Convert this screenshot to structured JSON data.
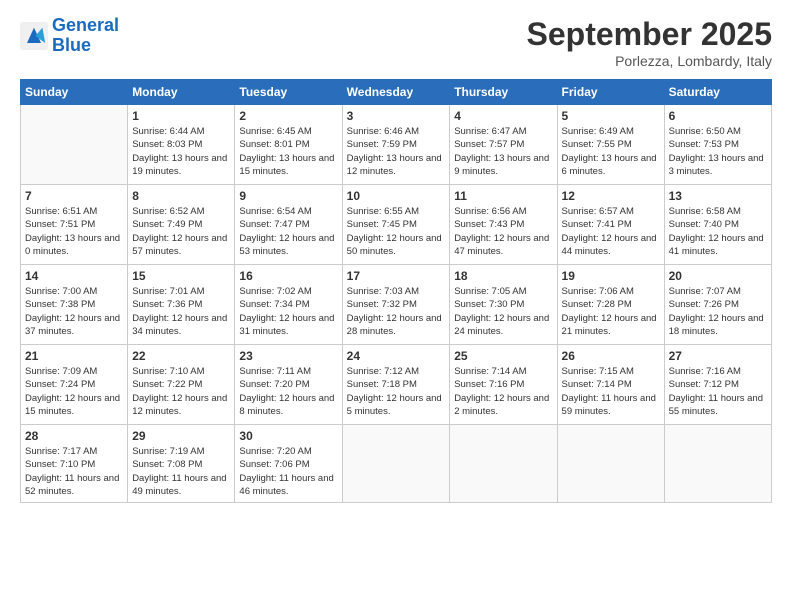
{
  "logo": {
    "line1": "General",
    "line2": "Blue"
  },
  "title": "September 2025",
  "location": "Porlezza, Lombardy, Italy",
  "days_of_week": [
    "Sunday",
    "Monday",
    "Tuesday",
    "Wednesday",
    "Thursday",
    "Friday",
    "Saturday"
  ],
  "weeks": [
    [
      {
        "day": "",
        "sunrise": "",
        "sunset": "",
        "daylight": ""
      },
      {
        "day": "1",
        "sunrise": "Sunrise: 6:44 AM",
        "sunset": "Sunset: 8:03 PM",
        "daylight": "Daylight: 13 hours and 19 minutes."
      },
      {
        "day": "2",
        "sunrise": "Sunrise: 6:45 AM",
        "sunset": "Sunset: 8:01 PM",
        "daylight": "Daylight: 13 hours and 15 minutes."
      },
      {
        "day": "3",
        "sunrise": "Sunrise: 6:46 AM",
        "sunset": "Sunset: 7:59 PM",
        "daylight": "Daylight: 13 hours and 12 minutes."
      },
      {
        "day": "4",
        "sunrise": "Sunrise: 6:47 AM",
        "sunset": "Sunset: 7:57 PM",
        "daylight": "Daylight: 13 hours and 9 minutes."
      },
      {
        "day": "5",
        "sunrise": "Sunrise: 6:49 AM",
        "sunset": "Sunset: 7:55 PM",
        "daylight": "Daylight: 13 hours and 6 minutes."
      },
      {
        "day": "6",
        "sunrise": "Sunrise: 6:50 AM",
        "sunset": "Sunset: 7:53 PM",
        "daylight": "Daylight: 13 hours and 3 minutes."
      }
    ],
    [
      {
        "day": "7",
        "sunrise": "Sunrise: 6:51 AM",
        "sunset": "Sunset: 7:51 PM",
        "daylight": "Daylight: 13 hours and 0 minutes."
      },
      {
        "day": "8",
        "sunrise": "Sunrise: 6:52 AM",
        "sunset": "Sunset: 7:49 PM",
        "daylight": "Daylight: 12 hours and 57 minutes."
      },
      {
        "day": "9",
        "sunrise": "Sunrise: 6:54 AM",
        "sunset": "Sunset: 7:47 PM",
        "daylight": "Daylight: 12 hours and 53 minutes."
      },
      {
        "day": "10",
        "sunrise": "Sunrise: 6:55 AM",
        "sunset": "Sunset: 7:45 PM",
        "daylight": "Daylight: 12 hours and 50 minutes."
      },
      {
        "day": "11",
        "sunrise": "Sunrise: 6:56 AM",
        "sunset": "Sunset: 7:43 PM",
        "daylight": "Daylight: 12 hours and 47 minutes."
      },
      {
        "day": "12",
        "sunrise": "Sunrise: 6:57 AM",
        "sunset": "Sunset: 7:41 PM",
        "daylight": "Daylight: 12 hours and 44 minutes."
      },
      {
        "day": "13",
        "sunrise": "Sunrise: 6:58 AM",
        "sunset": "Sunset: 7:40 PM",
        "daylight": "Daylight: 12 hours and 41 minutes."
      }
    ],
    [
      {
        "day": "14",
        "sunrise": "Sunrise: 7:00 AM",
        "sunset": "Sunset: 7:38 PM",
        "daylight": "Daylight: 12 hours and 37 minutes."
      },
      {
        "day": "15",
        "sunrise": "Sunrise: 7:01 AM",
        "sunset": "Sunset: 7:36 PM",
        "daylight": "Daylight: 12 hours and 34 minutes."
      },
      {
        "day": "16",
        "sunrise": "Sunrise: 7:02 AM",
        "sunset": "Sunset: 7:34 PM",
        "daylight": "Daylight: 12 hours and 31 minutes."
      },
      {
        "day": "17",
        "sunrise": "Sunrise: 7:03 AM",
        "sunset": "Sunset: 7:32 PM",
        "daylight": "Daylight: 12 hours and 28 minutes."
      },
      {
        "day": "18",
        "sunrise": "Sunrise: 7:05 AM",
        "sunset": "Sunset: 7:30 PM",
        "daylight": "Daylight: 12 hours and 24 minutes."
      },
      {
        "day": "19",
        "sunrise": "Sunrise: 7:06 AM",
        "sunset": "Sunset: 7:28 PM",
        "daylight": "Daylight: 12 hours and 21 minutes."
      },
      {
        "day": "20",
        "sunrise": "Sunrise: 7:07 AM",
        "sunset": "Sunset: 7:26 PM",
        "daylight": "Daylight: 12 hours and 18 minutes."
      }
    ],
    [
      {
        "day": "21",
        "sunrise": "Sunrise: 7:09 AM",
        "sunset": "Sunset: 7:24 PM",
        "daylight": "Daylight: 12 hours and 15 minutes."
      },
      {
        "day": "22",
        "sunrise": "Sunrise: 7:10 AM",
        "sunset": "Sunset: 7:22 PM",
        "daylight": "Daylight: 12 hours and 12 minutes."
      },
      {
        "day": "23",
        "sunrise": "Sunrise: 7:11 AM",
        "sunset": "Sunset: 7:20 PM",
        "daylight": "Daylight: 12 hours and 8 minutes."
      },
      {
        "day": "24",
        "sunrise": "Sunrise: 7:12 AM",
        "sunset": "Sunset: 7:18 PM",
        "daylight": "Daylight: 12 hours and 5 minutes."
      },
      {
        "day": "25",
        "sunrise": "Sunrise: 7:14 AM",
        "sunset": "Sunset: 7:16 PM",
        "daylight": "Daylight: 12 hours and 2 minutes."
      },
      {
        "day": "26",
        "sunrise": "Sunrise: 7:15 AM",
        "sunset": "Sunset: 7:14 PM",
        "daylight": "Daylight: 11 hours and 59 minutes."
      },
      {
        "day": "27",
        "sunrise": "Sunrise: 7:16 AM",
        "sunset": "Sunset: 7:12 PM",
        "daylight": "Daylight: 11 hours and 55 minutes."
      }
    ],
    [
      {
        "day": "28",
        "sunrise": "Sunrise: 7:17 AM",
        "sunset": "Sunset: 7:10 PM",
        "daylight": "Daylight: 11 hours and 52 minutes."
      },
      {
        "day": "29",
        "sunrise": "Sunrise: 7:19 AM",
        "sunset": "Sunset: 7:08 PM",
        "daylight": "Daylight: 11 hours and 49 minutes."
      },
      {
        "day": "30",
        "sunrise": "Sunrise: 7:20 AM",
        "sunset": "Sunset: 7:06 PM",
        "daylight": "Daylight: 11 hours and 46 minutes."
      },
      {
        "day": "",
        "sunrise": "",
        "sunset": "",
        "daylight": ""
      },
      {
        "day": "",
        "sunrise": "",
        "sunset": "",
        "daylight": ""
      },
      {
        "day": "",
        "sunrise": "",
        "sunset": "",
        "daylight": ""
      },
      {
        "day": "",
        "sunrise": "",
        "sunset": "",
        "daylight": ""
      }
    ]
  ]
}
